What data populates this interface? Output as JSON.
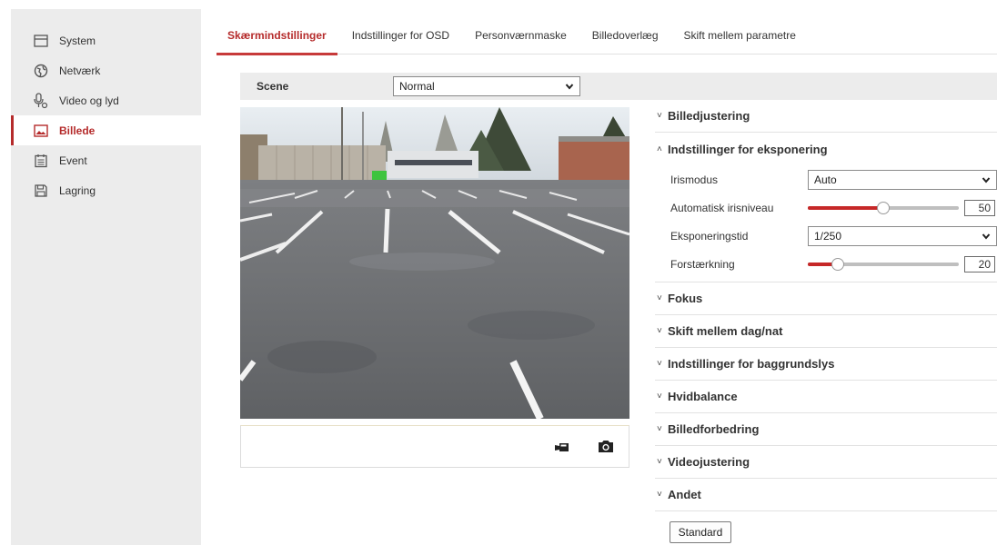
{
  "sidebar": {
    "items": [
      {
        "label": "System",
        "icon": "monitor-icon"
      },
      {
        "label": "Netværk",
        "icon": "globe-icon"
      },
      {
        "label": "Video og lyd",
        "icon": "microphone-icon"
      },
      {
        "label": "Billede",
        "icon": "image-icon",
        "active": true
      },
      {
        "label": "Event",
        "icon": "calendar-icon"
      },
      {
        "label": "Lagring",
        "icon": "floppy-icon"
      }
    ]
  },
  "tabs": [
    {
      "label": "Skærmindstillinger",
      "active": true
    },
    {
      "label": "Indstillinger for OSD"
    },
    {
      "label": "Personværnmaske"
    },
    {
      "label": "Billedoverlæg"
    },
    {
      "label": "Skift mellem parametre"
    }
  ],
  "scene": {
    "label": "Scene",
    "value": "Normal"
  },
  "sections": {
    "billedjustering": "Billedjustering",
    "eksponering": "Indstillinger for eksponering",
    "fokus": "Fokus",
    "dagnat": "Skift mellem dag/nat",
    "baggrundslys": "Indstillinger for baggrundslys",
    "hvidbalance": "Hvidbalance",
    "billedforbedring": "Billedforbedring",
    "videojustering": "Videojustering",
    "andet": "Andet"
  },
  "exposure": {
    "iris_mode": {
      "label": "Irismodus",
      "value": "Auto"
    },
    "auto_iris_level": {
      "label": "Automatisk irisniveau",
      "value": "50",
      "fraction": 0.5
    },
    "exposure_time": {
      "label": "Eksponeringstid",
      "value": "1/250"
    },
    "gain": {
      "label": "Forstærkning",
      "value": "20",
      "fraction": 0.2
    }
  },
  "buttons": {
    "standard": "Standard"
  },
  "colors": {
    "accent": "#b52b2b",
    "slider_fill": "#c62828"
  }
}
